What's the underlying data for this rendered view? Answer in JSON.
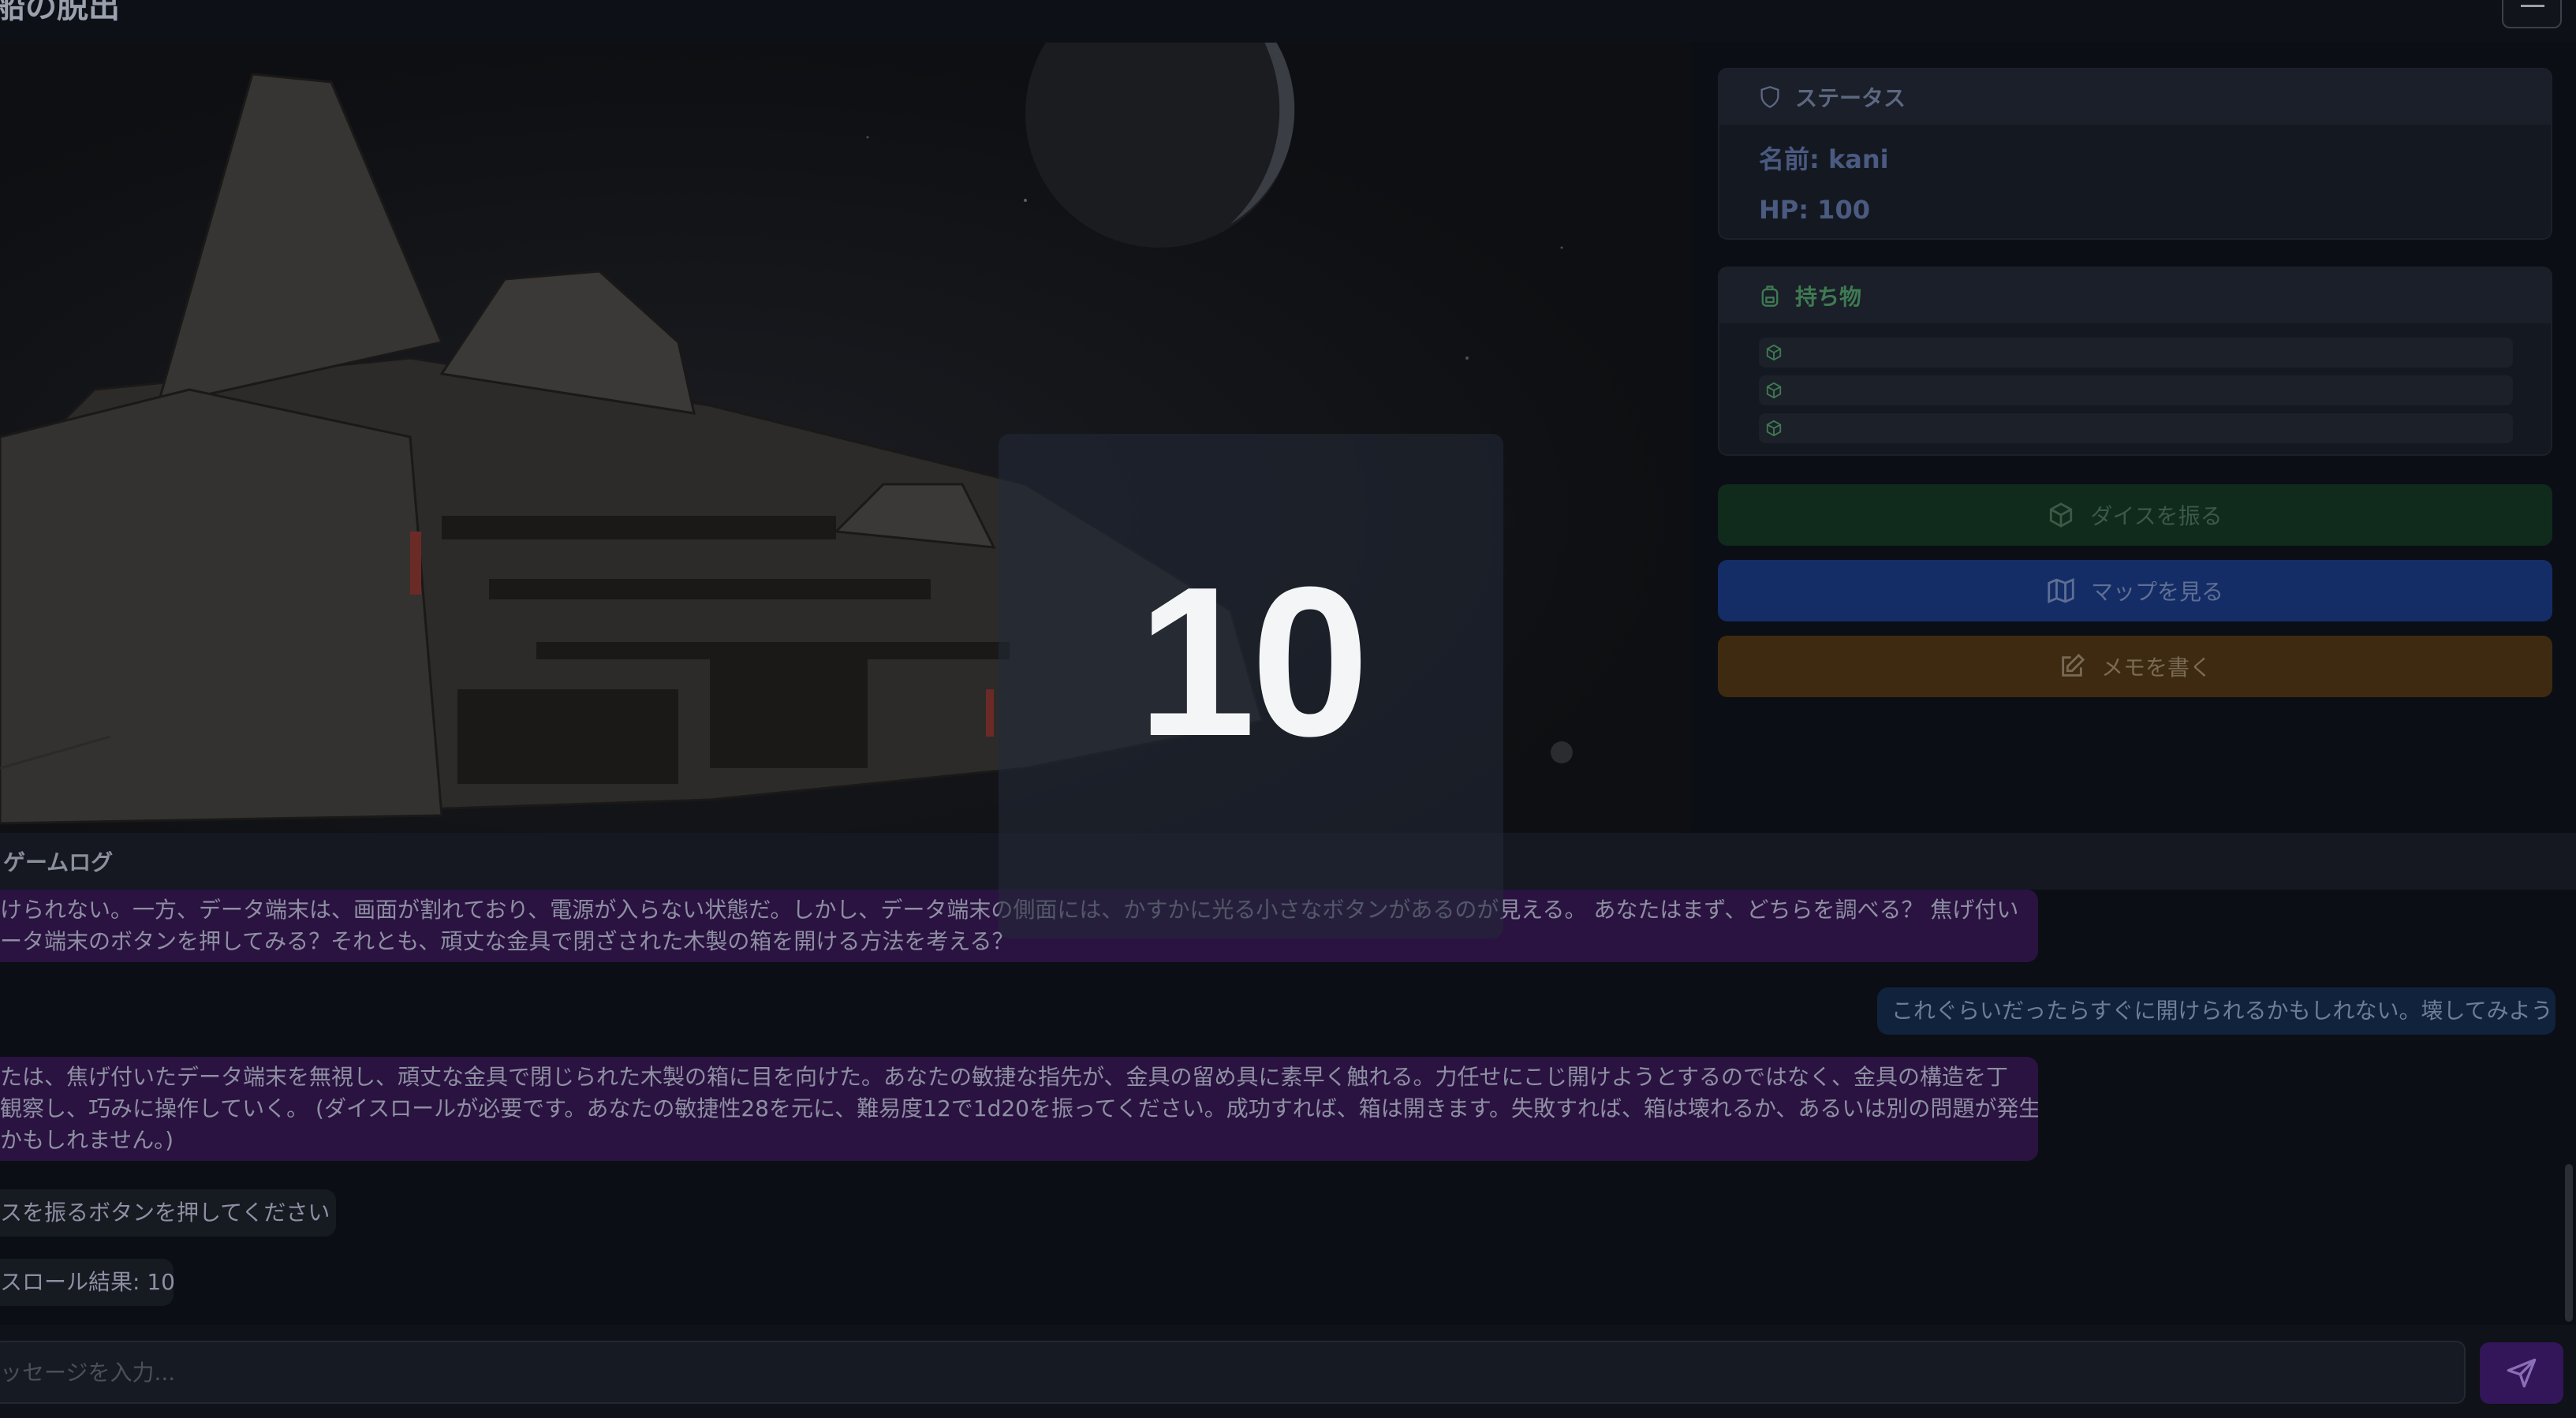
{
  "header": {
    "title": "船の脱出"
  },
  "status": {
    "heading": "ステータス",
    "name": "名前: kani",
    "hp": "HP: 100"
  },
  "inventory": {
    "heading": "持ち物",
    "items": [
      "",
      "",
      ""
    ]
  },
  "actions": {
    "dice": "ダイスを振る",
    "map": "マップを見る",
    "memo": "メモを書く"
  },
  "log": {
    "heading": "ゲームログ",
    "messages": [
      {
        "role": "ai",
        "line1": "けられない。一方、データ端末は、画面が割れており、電源が入らない状態だ。しかし、データ端末の側面には、かすかに光る小さなボタンがあるのが見える。 あなたはまず、どちらを調べる？ 焦げ付い",
        "line2": "ータ端末のボタンを押してみる？それとも、頑丈な金具で閉ざされた木製の箱を開ける方法を考える？"
      },
      {
        "role": "user",
        "text": "これぐらいだったらすぐに開けられるかもしれない。壊してみよう"
      },
      {
        "role": "ai",
        "line1": "たは、焦げ付いたデータ端末を無視し、頑丈な金具で閉じられた木製の箱に目を向けた。あなたの敏捷な指先が、金具の留め具に素早く触れる。力任せにこじ開けようとするのではなく、金具の構造を丁",
        "line2": "観察し、巧みに操作していく。 (ダイスロールが必要です。あなたの敏捷性28を元に、難易度12で1d20を振ってください。成功すれば、箱は開きます。失敗すれば、箱は壊れるか、あるいは別の問題が発生",
        "line3": "かもしれません。)"
      },
      {
        "role": "sys",
        "text": "スを振るボタンを押してください"
      },
      {
        "role": "sys",
        "text": "スロール結果: 10"
      }
    ]
  },
  "input": {
    "placeholder": "ッセージを入力..."
  },
  "dice_result": "10",
  "colors": {
    "ai_bubble": "#2a1340",
    "user_bubble": "#11223d",
    "dice_button": "#102a1c",
    "map_button": "#152d66",
    "memo_button": "#3d2a10",
    "send_button": "#321659"
  },
  "icons": {
    "status": "shield-icon",
    "inventory": "backpack-icon",
    "item": "box-icon",
    "dice": "dice-icon",
    "map": "map-icon",
    "memo": "edit-icon",
    "send": "send-icon",
    "menu": "menu-icon"
  }
}
